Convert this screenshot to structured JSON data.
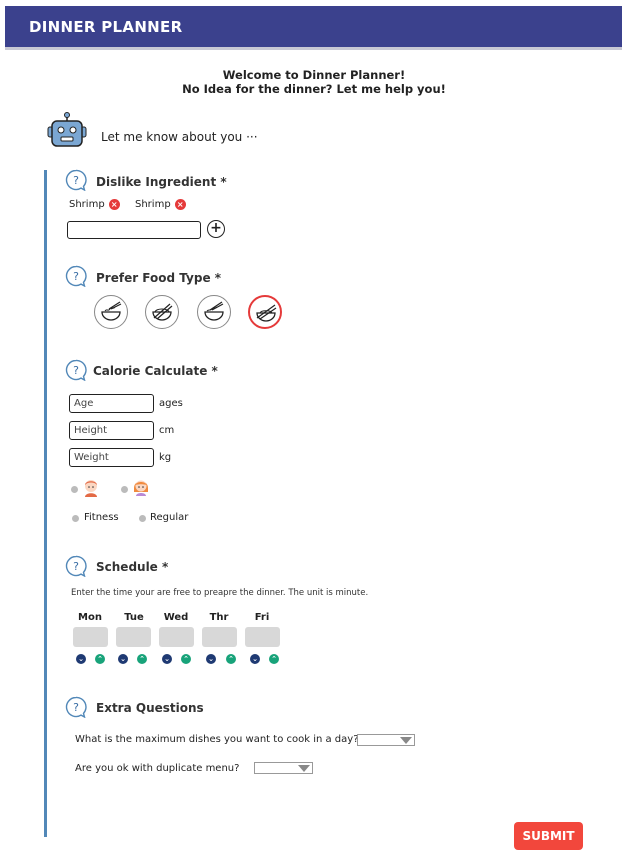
{
  "header": {
    "title": "DINNER PLANNER"
  },
  "welcome": {
    "line1": "Welcome to Dinner Planner!",
    "line2": "No Idea for the dinner? Let me help you!"
  },
  "bot": {
    "text": "Let me know about you ···"
  },
  "dislike": {
    "title": "Dislike Ingredient *",
    "chips": [
      {
        "label": "Shrimp"
      },
      {
        "label": "Shrimp"
      }
    ],
    "input_value": "",
    "add_symbol": "+"
  },
  "food": {
    "title": "Prefer Food Type *",
    "selected_index": 3
  },
  "calorie": {
    "title": "Calorie Calculate *",
    "age_placeholder": "Age",
    "age_unit": "ages",
    "height_placeholder": "Height",
    "height_unit": "cm",
    "weight_placeholder": "Weight",
    "weight_unit": "kg",
    "goal_fitness": "Fitness",
    "goal_regular": "Regular"
  },
  "schedule": {
    "title": "Schedule *",
    "instruction": "Enter the time your are free to preapre the dinner. The unit is minute.",
    "days": [
      "Mon",
      "Tue",
      "Wed",
      "Thr",
      "Fri"
    ]
  },
  "extra": {
    "title": "Extra Questions",
    "q1": "What is the maximum dishes you want to cook in a day?",
    "q2": "Are you ok with duplicate menu?"
  },
  "submit": {
    "label": "SUBMIT"
  },
  "colors": {
    "header": "#3b418d",
    "accent_line": "#5288b8",
    "submit": "#f2473c",
    "remove": "#e53a3a"
  }
}
